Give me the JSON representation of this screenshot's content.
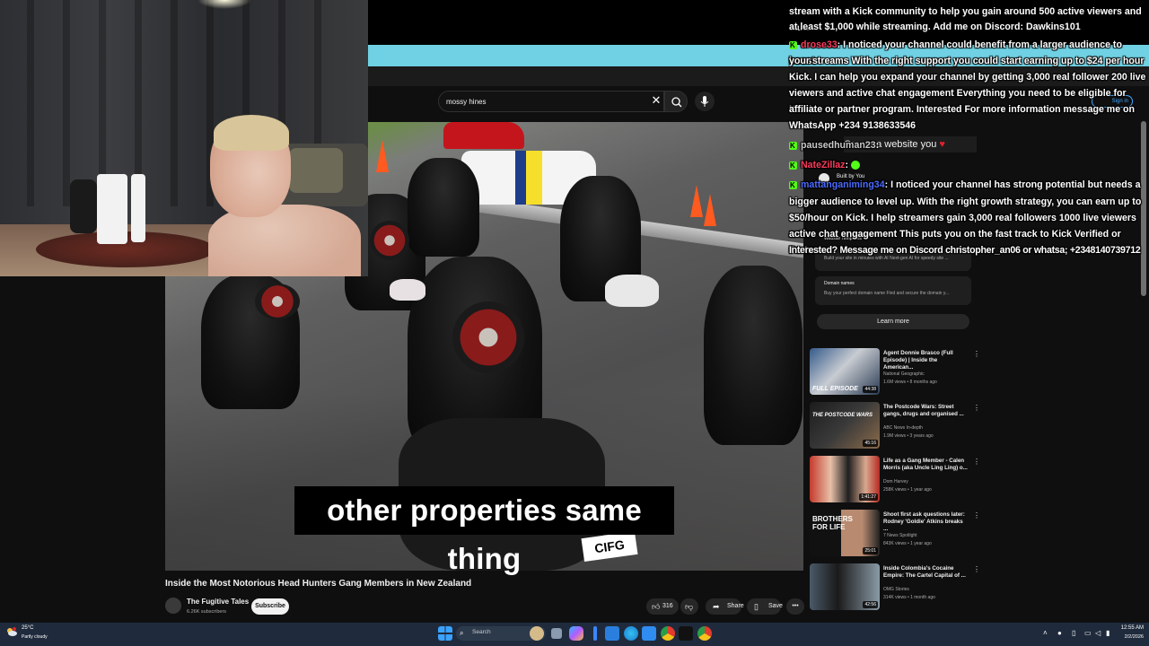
{
  "youtube": {
    "search": {
      "value": "mossy hines"
    },
    "signin_label": "Sign in",
    "video": {
      "caption": "other properties same thing",
      "title": "Inside the Most Notorious Head Hunters Gang Members in New Zealand",
      "channel": "The Fugitive Tales",
      "subscribers": "6.26K subscribers",
      "subscribe_label": "Subscribe",
      "likes": "316",
      "share_label": "Share",
      "save_label": "Save"
    },
    "ad": {
      "headline": "Create a website you",
      "built_by": "Built by You",
      "item1_title": "Website Templates",
      "item1_desc": "Build your site in minutes with AI Next-gen AI for speedy site ...",
      "item2_title": "Domain names",
      "item2_desc": "Buy your perfect domain name Find and secure the domain y...",
      "learn_more": "Learn more"
    },
    "related": [
      {
        "title": "Agent Donnie Brasco (Full Episode) | Inside the American...",
        "channel": "National Geographic",
        "meta": "1.6M views • 8 months ago",
        "duration": "44:38",
        "thumb_label": "FULL EPISODE"
      },
      {
        "title": "The Postcode Wars: Street gangs, drugs and organised ...",
        "channel": "ABC News In-depth",
        "meta": "1.9M views • 3 years ago",
        "duration": "45:16",
        "thumb_label": "THE POSTCODE WARS"
      },
      {
        "title": "Life as a Gang Member - Calen Morris (aka Uncle Ling Ling) o...",
        "channel": "Dom Harvey",
        "meta": "258K views • 1 year ago",
        "duration": "1:41:27",
        "thumb_label": ""
      },
      {
        "title": "Shoot first ask questions later: Rodney 'Goldie' Atkins breaks ...",
        "channel": "7 News Spotlight",
        "meta": "843K views • 1 year ago",
        "duration": "25:01",
        "thumb_label": "BROTHERS FOR LIFE"
      },
      {
        "title": "Inside Colombia's Cocaine Empire: The Cartel Capital of ...",
        "channel": "OMG Stories",
        "meta": "314K views • 1 month ago",
        "duration": "42:56",
        "thumb_label": ""
      }
    ]
  },
  "chat": {
    "messages": [
      {
        "user": "",
        "text": "stream with a Kick community to help you gain around 500 active viewers and earn"
      },
      {
        "user": "",
        "text": "at least $1,000 while streaming. Add me on Discord: Dawkins101"
      },
      {
        "user": "drose33",
        "text": ": I noticed your channel could benefit from a larger audience to boost"
      },
      {
        "user": "",
        "text": "your streams With the right support you could start earning up to $24 per hour on"
      },
      {
        "user": "",
        "text": "Kick. I can help you expand your channel by getting 3,000 real follower 200 live"
      },
      {
        "user": "",
        "text": "viewers and active chat engagement Everything you need to be eligible for Kick's"
      },
      {
        "user": "",
        "text": "affiliate or partner program. Interested For more information message me on"
      },
      {
        "user": "",
        "text": "WhatsApp +234 9138633546"
      },
      {
        "user": "pausedhuman23",
        "text": ":"
      },
      {
        "user": "NateZillaz",
        "text": ":"
      },
      {
        "user": "mattanganiming34",
        "text": ": I noticed your channel has strong potential but needs a"
      },
      {
        "user": "",
        "text": "bigger audience to level up. With the right growth strategy, you can earn up to"
      },
      {
        "user": "",
        "text": "$50/hour on Kick. I help streamers gain 3,000 real followers 1000 live viewers and"
      },
      {
        "user": "",
        "text": "active chat engagement This puts you on the fast track to Kick Verified or Partner"
      },
      {
        "user": "",
        "text": "Interested? Message me on Discord christopher_an06 or whatsa; +2348140739712"
      }
    ]
  },
  "taskbar": {
    "weather_temp": "25°C",
    "weather_desc": "Partly cloudy",
    "search_placeholder": "Search",
    "time": "12:55 AM",
    "date": "2/2/2026"
  },
  "colors": {
    "kick_green": "#53fc18",
    "youtube_bg": "#0f0f0f",
    "taskbar_bg": "#1f2b3c",
    "browser_band": "#6fd1e3"
  }
}
